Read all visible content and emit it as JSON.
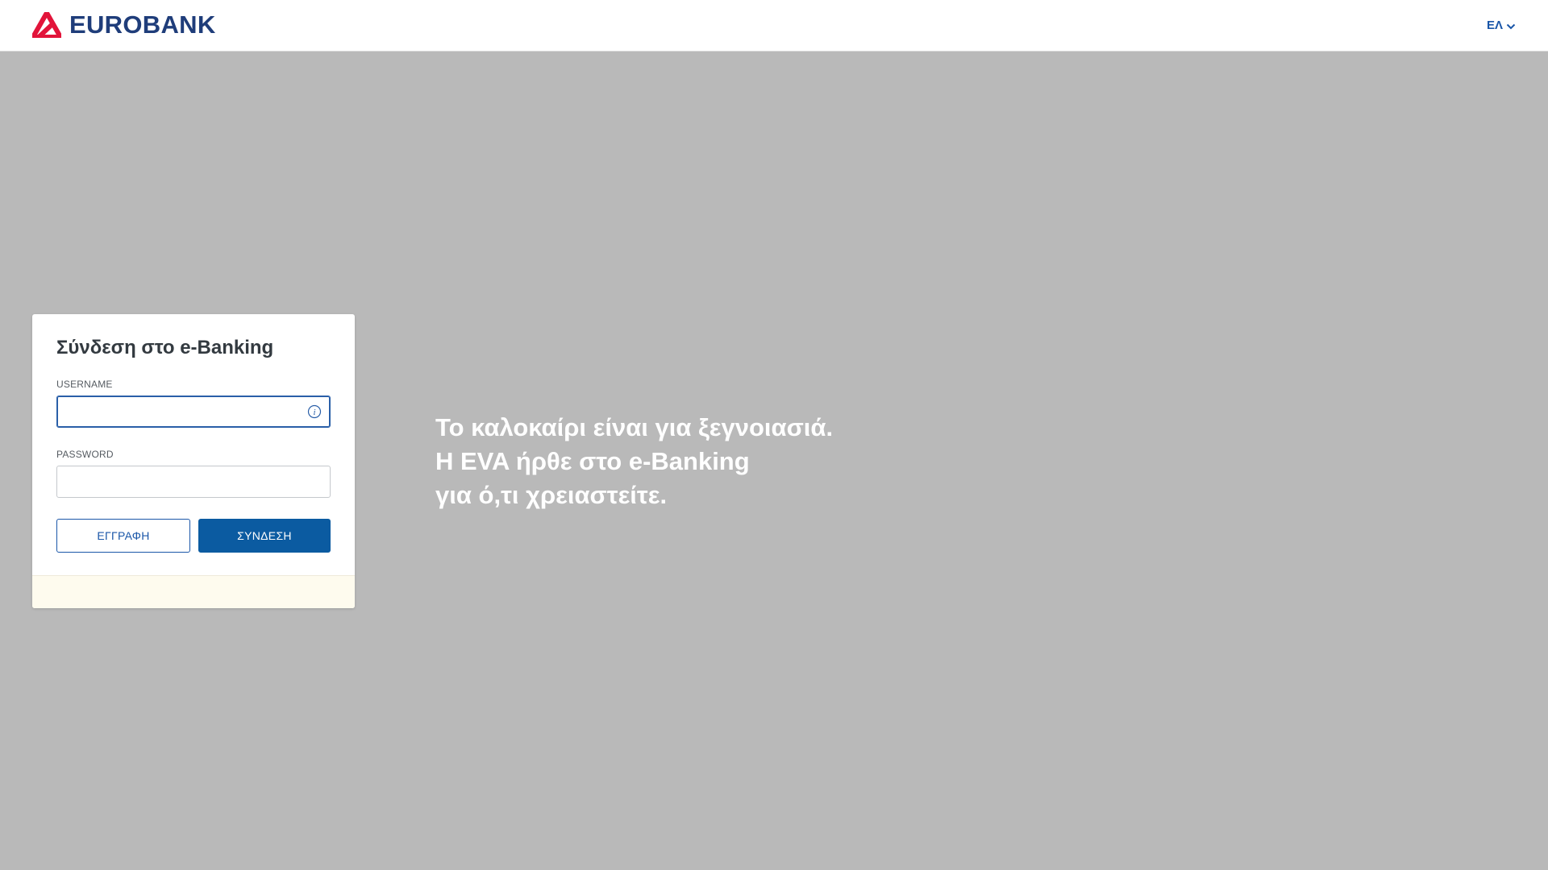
{
  "header": {
    "brand": "EUROBANK",
    "language": "ΕΛ",
    "colors": {
      "logo_red": "#e2143a",
      "logo_navy": "#1f3d7a",
      "link_blue": "#1a56a8"
    }
  },
  "login": {
    "title": "Σύνδεση στο e-Banking",
    "username_label": "USERNAME",
    "username_value": "",
    "password_label": "PASSWORD",
    "password_value": "",
    "register_button": "ΕΓΓΡΑΦΗ",
    "login_button": "ΣΥΝΔΕΣΗ",
    "colors": {
      "primary": "#0b5ba1",
      "footer_bg": "#fefbee"
    }
  },
  "promo": {
    "lines": [
      "Το καλοκαίρι είναι για ξεγνοιασιά.",
      "Η EVA ήρθε στο e-Banking",
      "για ό,τι χρειαστείτε."
    ]
  },
  "icons": {
    "logo": "eurobank-logo-icon",
    "language_caret": "chevron-down-icon",
    "username_info": "info-icon"
  }
}
